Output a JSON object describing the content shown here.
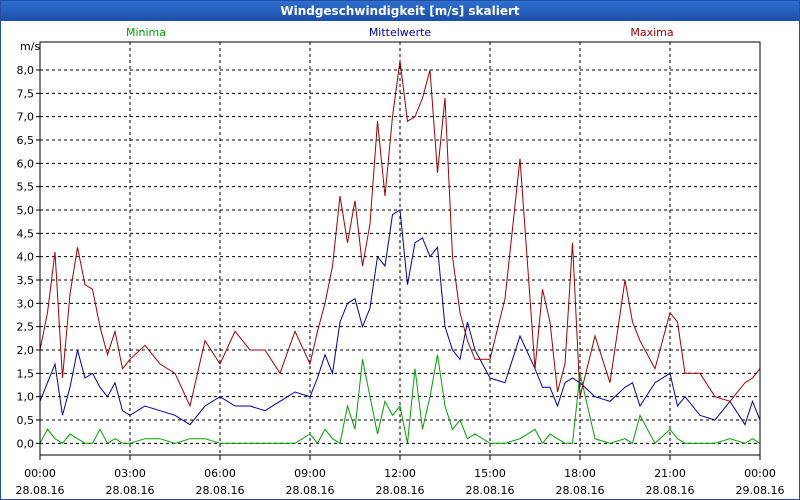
{
  "window": {
    "title": "Windgeschwindigkeit [m/s] skaliert"
  },
  "chart_data": {
    "type": "line",
    "title": "Windgeschwindigkeit [m/s] skaliert",
    "ylabel": "m/s",
    "ylim": [
      -0.25,
      8.6
    ],
    "yticks": [
      "0,0",
      "0,5",
      "1,0",
      "1,5",
      "2,0",
      "2,5",
      "3,0",
      "3,5",
      "4,0",
      "4,5",
      "5,0",
      "5,5",
      "6,0",
      "6,5",
      "7,0",
      "7,5",
      "8,0"
    ],
    "xlim_hours": [
      0,
      24
    ],
    "xticks": [
      {
        "time": "00:00",
        "date": "28.08.16"
      },
      {
        "time": "03:00",
        "date": "28.08.16"
      },
      {
        "time": "06:00",
        "date": "28.08.16"
      },
      {
        "time": "09:00",
        "date": "28.08.16"
      },
      {
        "time": "12:00",
        "date": "28.08.16"
      },
      {
        "time": "15:00",
        "date": "28.08.16"
      },
      {
        "time": "18:00",
        "date": "28.08.16"
      },
      {
        "time": "21:00",
        "date": "28.08.16"
      },
      {
        "time": "00:00",
        "date": "29.08.16"
      }
    ],
    "grid": true,
    "legend_position": "top",
    "series": [
      {
        "name": "Minima",
        "color": "#00a000",
        "x": [
          0,
          0.25,
          0.5,
          0.75,
          1,
          1.25,
          1.5,
          1.75,
          2,
          2.25,
          2.5,
          2.75,
          3,
          3.5,
          4,
          4.5,
          5,
          5.5,
          6,
          6.5,
          7,
          7.5,
          8,
          8.5,
          9,
          9.25,
          9.5,
          9.75,
          10,
          10.25,
          10.5,
          10.75,
          11,
          11.25,
          11.5,
          11.75,
          12,
          12.25,
          12.5,
          12.75,
          13,
          13.25,
          13.5,
          13.75,
          14,
          14.25,
          14.5,
          15,
          15.5,
          16,
          16.5,
          16.75,
          17,
          17.25,
          17.5,
          17.75,
          18,
          18.5,
          19,
          19.5,
          19.75,
          20,
          20.5,
          21,
          21.25,
          21.5,
          22,
          22.5,
          23,
          23.5,
          23.75,
          24
        ],
        "values": [
          0.0,
          0.3,
          0.1,
          0.0,
          0.2,
          0.1,
          0.0,
          0.0,
          0.3,
          0.0,
          0.1,
          0.0,
          0.0,
          0.1,
          0.1,
          0.0,
          0.1,
          0.1,
          0.0,
          0.0,
          0.0,
          0.0,
          0.0,
          0.0,
          0.2,
          0.0,
          0.3,
          0.1,
          0.0,
          0.8,
          0.3,
          1.8,
          1.0,
          0.2,
          0.9,
          0.6,
          0.8,
          0.0,
          1.6,
          0.3,
          1.0,
          1.9,
          0.8,
          0.3,
          0.5,
          0.1,
          0.2,
          0.0,
          0.0,
          0.1,
          0.3,
          0.0,
          0.2,
          0.1,
          0.0,
          0.0,
          1.5,
          0.1,
          0.0,
          0.1,
          0.0,
          0.6,
          0.0,
          0.3,
          0.1,
          0.0,
          0.0,
          0.0,
          0.1,
          0.0,
          0.1,
          0.0
        ]
      },
      {
        "name": "Mittelwerte",
        "color": "#0000a0",
        "x": [
          0,
          0.25,
          0.5,
          0.75,
          1,
          1.25,
          1.5,
          1.75,
          2,
          2.25,
          2.5,
          2.75,
          3,
          3.5,
          4,
          4.5,
          5,
          5.5,
          6,
          6.5,
          7,
          7.5,
          8,
          8.5,
          9,
          9.25,
          9.5,
          9.75,
          10,
          10.25,
          10.5,
          10.75,
          11,
          11.25,
          11.5,
          11.75,
          12,
          12.25,
          12.5,
          12.75,
          13,
          13.25,
          13.5,
          13.75,
          14,
          14.25,
          14.5,
          15,
          15.5,
          16,
          16.5,
          16.75,
          17,
          17.25,
          17.5,
          17.75,
          18,
          18.5,
          19,
          19.5,
          19.75,
          20,
          20.5,
          21,
          21.25,
          21.5,
          22,
          22.5,
          23,
          23.5,
          23.75,
          24
        ],
        "values": [
          0.9,
          1.3,
          1.7,
          0.6,
          1.2,
          2.0,
          1.4,
          1.5,
          1.2,
          1.0,
          1.3,
          0.7,
          0.6,
          0.8,
          0.7,
          0.6,
          0.4,
          0.8,
          1.0,
          0.8,
          0.8,
          0.7,
          0.9,
          1.1,
          1.0,
          1.4,
          1.9,
          1.5,
          2.6,
          3.0,
          3.1,
          2.5,
          2.9,
          4.0,
          3.8,
          4.9,
          5.0,
          3.4,
          4.3,
          4.4,
          4.0,
          4.2,
          2.5,
          2.0,
          1.8,
          2.6,
          2.0,
          1.4,
          1.3,
          2.3,
          1.6,
          1.2,
          1.2,
          0.8,
          1.3,
          1.4,
          1.3,
          1.0,
          0.9,
          1.2,
          1.3,
          0.8,
          1.3,
          1.5,
          0.8,
          1.0,
          0.6,
          0.5,
          0.9,
          0.4,
          0.9,
          0.5
        ]
      },
      {
        "name": "Maxima",
        "color": "#a00000",
        "x": [
          0,
          0.25,
          0.5,
          0.75,
          1,
          1.25,
          1.5,
          1.75,
          2,
          2.25,
          2.5,
          2.75,
          3,
          3.5,
          4,
          4.5,
          5,
          5.5,
          6,
          6.5,
          7,
          7.5,
          8,
          8.5,
          9,
          9.25,
          9.5,
          9.75,
          10,
          10.25,
          10.5,
          10.75,
          11,
          11.25,
          11.5,
          11.75,
          12,
          12.25,
          12.5,
          12.75,
          13,
          13.25,
          13.5,
          13.75,
          14,
          14.25,
          14.5,
          15,
          15.5,
          16,
          16.5,
          16.75,
          17,
          17.25,
          17.5,
          17.75,
          18,
          18.5,
          19,
          19.5,
          19.75,
          20,
          20.5,
          21,
          21.25,
          21.5,
          22,
          22.5,
          23,
          23.5,
          23.75,
          24
        ],
        "values": [
          2.0,
          2.8,
          4.1,
          1.4,
          3.2,
          4.2,
          3.4,
          3.3,
          2.5,
          1.9,
          2.4,
          1.6,
          1.8,
          2.1,
          1.7,
          1.5,
          0.8,
          2.2,
          1.7,
          2.4,
          2.0,
          2.0,
          1.5,
          2.4,
          1.7,
          2.4,
          3.0,
          3.8,
          5.3,
          4.3,
          5.2,
          3.8,
          4.7,
          6.9,
          5.3,
          7.0,
          8.2,
          6.9,
          7.0,
          7.4,
          8.0,
          5.8,
          7.4,
          4.0,
          2.8,
          2.2,
          1.8,
          1.8,
          3.1,
          6.1,
          1.6,
          3.3,
          2.6,
          1.1,
          1.7,
          4.3,
          1.0,
          2.3,
          1.3,
          3.5,
          2.6,
          2.2,
          1.6,
          2.8,
          2.6,
          1.5,
          1.5,
          1.0,
          0.9,
          1.3,
          1.4,
          1.6
        ]
      }
    ]
  }
}
